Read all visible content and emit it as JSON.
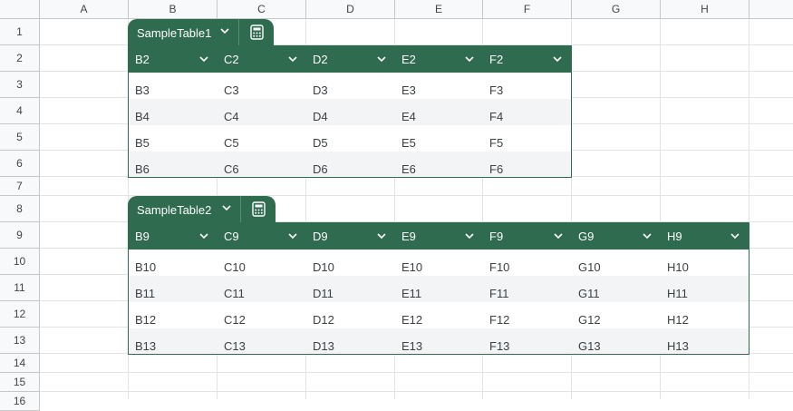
{
  "columns": [
    "A",
    "B",
    "C",
    "D",
    "E",
    "F",
    "G",
    "H"
  ],
  "rows": [
    "1",
    "2",
    "3",
    "4",
    "5",
    "6",
    "7",
    "8",
    "9",
    "10",
    "11",
    "12",
    "13",
    "14",
    "15",
    "16"
  ],
  "tables": [
    {
      "name": "SampleTable1",
      "headers": [
        "B2",
        "C2",
        "D2",
        "E2",
        "F2"
      ],
      "data": [
        [
          "B3",
          "C3",
          "D3",
          "E3",
          "F3"
        ],
        [
          "B4",
          "C4",
          "D4",
          "E4",
          "F4"
        ],
        [
          "B5",
          "C5",
          "D5",
          "E5",
          "F5"
        ],
        [
          "B6",
          "C6",
          "D6",
          "E6",
          "F6"
        ]
      ]
    },
    {
      "name": "SampleTable2",
      "headers": [
        "B9",
        "C9",
        "D9",
        "E9",
        "F9",
        "G9",
        "H9"
      ],
      "data": [
        [
          "B10",
          "C10",
          "D10",
          "E10",
          "F10",
          "G10",
          "H10"
        ],
        [
          "B11",
          "C11",
          "D11",
          "E11",
          "F11",
          "G11",
          "H11"
        ],
        [
          "B12",
          "C12",
          "D12",
          "E12",
          "F12",
          "G12",
          "H12"
        ],
        [
          "B13",
          "C13",
          "D13",
          "E13",
          "F13",
          "G13",
          "H13"
        ]
      ]
    }
  ],
  "colors": {
    "table_green": "#2f6b4f",
    "alt_row": "#f2f4f6"
  },
  "icons": {
    "dropdown": "chevron-down-icon",
    "calculator": "calculator-icon"
  }
}
